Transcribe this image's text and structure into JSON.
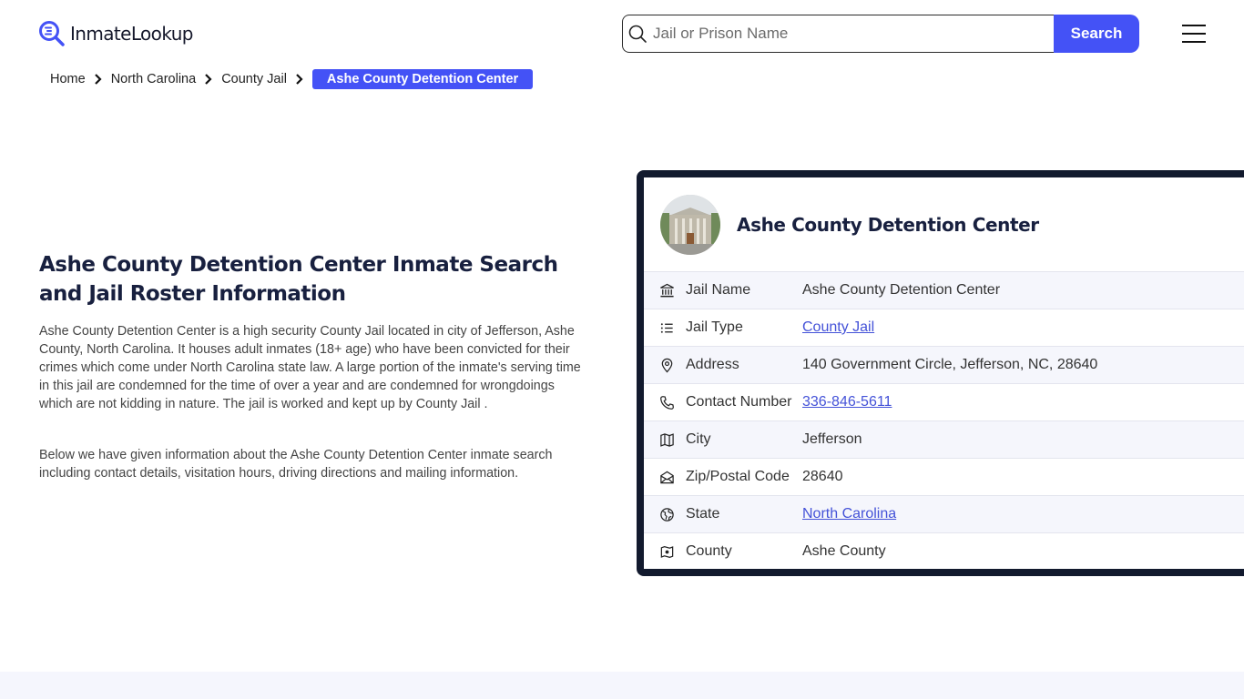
{
  "header": {
    "logo_text": "InmateLookup",
    "search_placeholder": "Jail or Prison Name",
    "search_value": "",
    "search_button": "Search",
    "menu_icon": "hamburger-icon"
  },
  "breadcrumb": {
    "items": [
      "Home",
      "North Carolina",
      "County Jail"
    ],
    "current": "Ashe County Detention Center"
  },
  "main": {
    "title": "Ashe County Detention Center Inmate Search and Jail Roster Information",
    "paragraph1": "Ashe County Detention Center is a high security County Jail located in city of Jefferson, Ashe County, North Carolina. It houses adult inmates (18+ age) who have been convicted for their crimes which come under North Carolina state law. A large portion of the inmate's serving time in this jail are condemned for the time of over a year and are condemned for wrongdoings which are not kidding in nature. The jail is worked and kept up by County Jail .",
    "paragraph2": "Below we have given information about the Ashe County Detention Center inmate search including contact details, visitation hours, driving directions and mailing information."
  },
  "card": {
    "title": "Ashe County Detention Center",
    "rows": [
      {
        "icon": "building-icon",
        "label": "Jail Name",
        "value": "Ashe County Detention Center",
        "link": false
      },
      {
        "icon": "list-icon",
        "label": "Jail Type",
        "value": "County Jail",
        "link": true
      },
      {
        "icon": "location-pin-icon",
        "label": "Address",
        "value": "140 Government Circle, Jefferson, NC, 28640",
        "link": false
      },
      {
        "icon": "phone-icon",
        "label": "Contact Number",
        "value": "336-846-5611",
        "link": true
      },
      {
        "icon": "map-icon",
        "label": "City",
        "value": "Jefferson",
        "link": false
      },
      {
        "icon": "envelope-icon",
        "label": "Zip/Postal Code",
        "value": "28640",
        "link": false
      },
      {
        "icon": "globe-icon",
        "label": "State",
        "value": "North Carolina",
        "link": true
      },
      {
        "icon": "map-marker-icon",
        "label": "County",
        "value": "Ashe County",
        "link": false
      }
    ]
  },
  "colors": {
    "accent": "#4452f6",
    "card_border": "#121a2e",
    "title_text": "#18203f",
    "link": "#4452d8",
    "row_alt_bg": "#f5f6fc"
  }
}
